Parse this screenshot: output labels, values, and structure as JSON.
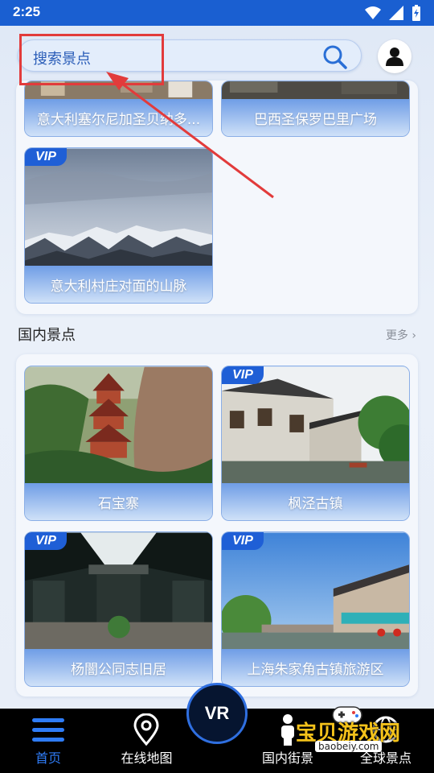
{
  "status_bar": {
    "time": "2:25"
  },
  "search": {
    "placeholder": "搜索景点"
  },
  "top_section": {
    "cards": [
      {
        "name": "意大利塞尔尼加圣贝纳多...",
        "vip": false
      },
      {
        "name": "巴西圣保罗巴里广场",
        "vip": false
      },
      {
        "name": "意大利村庄对面的山脉",
        "vip": true
      }
    ]
  },
  "domestic": {
    "title": "国内景点",
    "more": "更多",
    "cards": [
      {
        "name": "石宝寨",
        "vip": false
      },
      {
        "name": "枫泾古镇",
        "vip": true
      },
      {
        "name": "杨闇公同志旧居",
        "vip": true
      },
      {
        "name": "上海朱家角古镇旅游区",
        "vip": true
      }
    ]
  },
  "vip_badge": "VIP",
  "tabbar": {
    "tabs": [
      {
        "label": "首页",
        "active": true
      },
      {
        "label": "在线地图",
        "active": false
      },
      {
        "label": "国内街景",
        "active": false
      },
      {
        "label": "全球景点",
        "active": false
      }
    ],
    "vr_label": "VR"
  },
  "watermark": {
    "text": "宝贝游戏网",
    "url": "baobeiy.com"
  },
  "colors": {
    "accent": "#1a5fd1",
    "tab_active": "#2f7cf6",
    "annotation": "#e23b3b"
  }
}
